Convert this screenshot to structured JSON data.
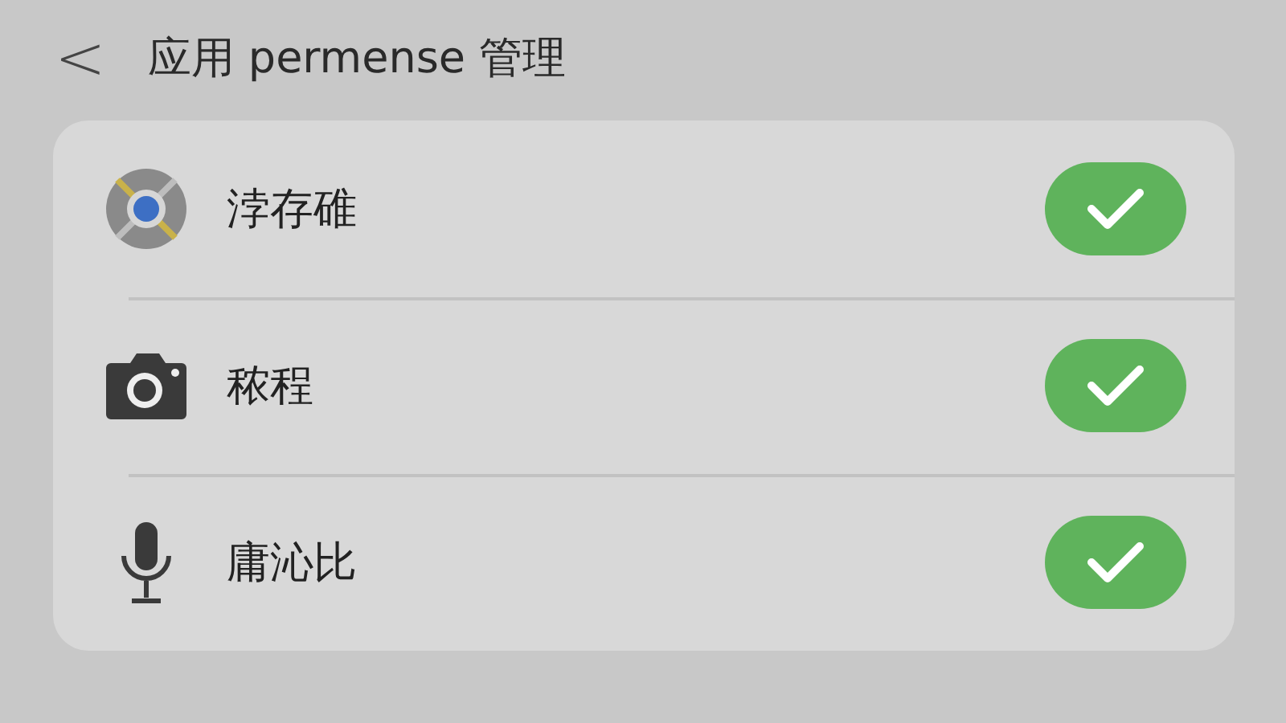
{
  "header": {
    "back": "<",
    "title": "应用 permense 管理"
  },
  "permissions": [
    {
      "kind": "storage",
      "label": "浡存碓",
      "checked": true
    },
    {
      "kind": "camera",
      "label": "秾程",
      "checked": true
    },
    {
      "kind": "microphone",
      "label": "庸沁比",
      "checked": true
    }
  ]
}
